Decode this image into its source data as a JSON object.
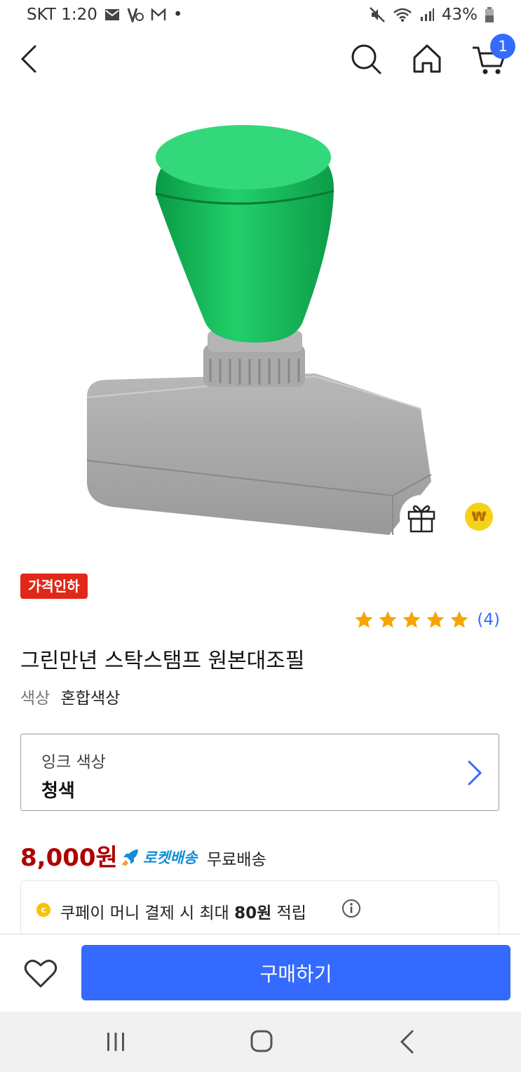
{
  "status_bar": {
    "carrier_time": "SKT 1:20",
    "dot": "•",
    "battery": "43%",
    "icons": [
      "mail-icon",
      "vpn-icon",
      "gmail-icon",
      "mute-icon",
      "wifi-icon",
      "signal-icon",
      "battery-icon"
    ]
  },
  "header": {
    "icons": [
      "back-arrow-icon",
      "search-icon",
      "home-icon",
      "cart-icon"
    ],
    "cart_count": "1"
  },
  "product": {
    "image_icons": [
      "gift-icon",
      "won-coin-icon"
    ],
    "cash_symbol": "₩",
    "discount_tag": "가격인하",
    "rating_stars": 5,
    "review_count": "(4)",
    "title": "그린만년 스탁스탬프 원본대조필",
    "color_label": "색상",
    "color_value": "혼합색상"
  },
  "option": {
    "label": "잉크 색상",
    "value": "청색"
  },
  "price": {
    "amount": "8,000원",
    "rocket_label": "로켓배송",
    "shipping": "무료배송"
  },
  "coupay": {
    "coin_symbol": "c",
    "text_before": "쿠페이 머니 결제 시 최대 ",
    "amount": "80원",
    "text_after": " 적립"
  },
  "bottom": {
    "buy_label": "구매하기"
  },
  "colors": {
    "accent": "#346aff",
    "price": "#ae0000",
    "discount_tag": "#e0281a",
    "star": "#f5a500",
    "rocket": "#0f8ed6"
  }
}
